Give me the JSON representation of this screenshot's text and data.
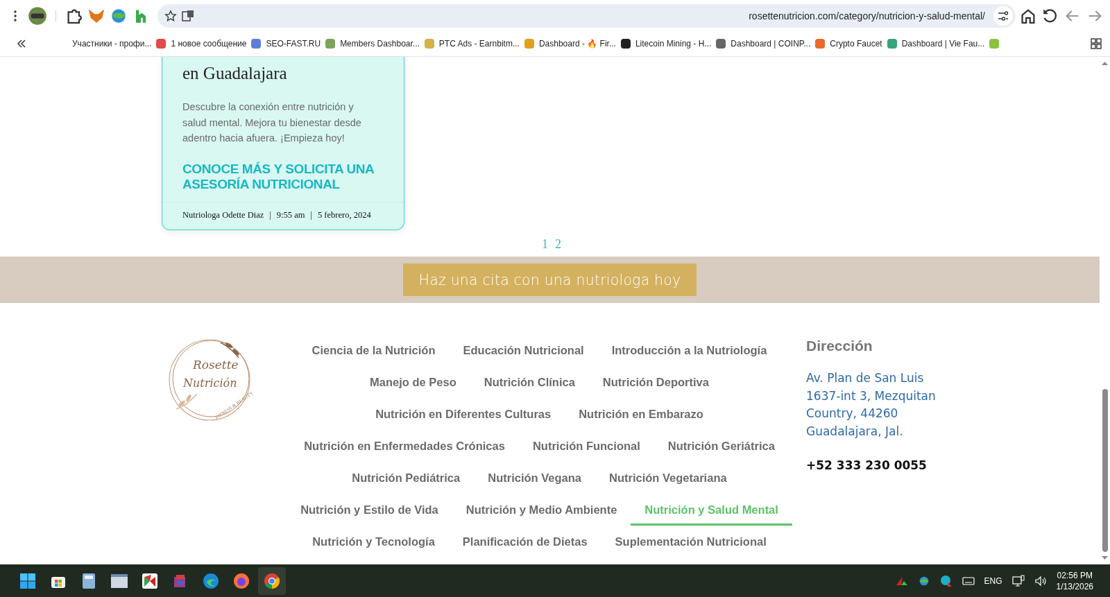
{
  "browser": {
    "url": "rosettenutricion.com/category/nutricion-y-salud-mental/",
    "bookmarks": [
      {
        "label": "Участники - профи..."
      },
      {
        "label": "1 новое сообщение"
      },
      {
        "label": "SEO-FAST.RU"
      },
      {
        "label": "Members Dashboar..."
      },
      {
        "label": "PTC Ads - Earnbitm..."
      },
      {
        "label": "Dashboard - 🔥 Fir..."
      },
      {
        "label": "Litecoin Mining - H..."
      },
      {
        "label": "Dashboard | COINP..."
      },
      {
        "label": "Crypto Faucet"
      },
      {
        "label": "Dashboard | Vie Fau..."
      }
    ]
  },
  "card": {
    "title": "en Guadalajara",
    "excerpt": "Descubre la conexión entre nutrición y salud mental. Mejora tu bienestar desde adentro hacia afuera. ¡Empieza hoy!",
    "link": "CONOCE MÁS Y SOLICITA UNA ASESORÍA NUTRICIONAL",
    "author": "Nutriologa Odette Diaz",
    "time": "9:55 am",
    "date": "5 febrero, 2024",
    "separator": "|"
  },
  "pagination": [
    {
      "label": "1"
    },
    {
      "label": "2"
    }
  ],
  "cta": {
    "button": "Haz una cita con una nutriologa hoy"
  },
  "footer": {
    "logo": {
      "line_1": "Rosette",
      "line_2": "Nutrición",
      "tagline": "FITNESS & BEAUTY"
    },
    "category_rows": [
      [
        {
          "label": "Ciencia de la Nutrición",
          "selected": false
        },
        {
          "label": "Educación Nutricional",
          "selected": false
        },
        {
          "label": "Introducción a la Nutriología",
          "selected": false
        }
      ],
      [
        {
          "label": "Manejo de Peso",
          "selected": false
        },
        {
          "label": "Nutrición Clínica",
          "selected": false
        },
        {
          "label": "Nutrición Deportiva",
          "selected": false
        }
      ],
      [
        {
          "label": "Nutrición en Diferentes Culturas",
          "selected": false
        },
        {
          "label": "Nutrición en Embarazo",
          "selected": false
        }
      ],
      [
        {
          "label": "Nutrición en Enfermedades Crónicas",
          "selected": false
        },
        {
          "label": "Nutrición Funcional",
          "selected": false
        },
        {
          "label": "Nutrición Geriátrica",
          "selected": false
        }
      ],
      [
        {
          "label": "Nutrición Pediátrica",
          "selected": false
        },
        {
          "label": "Nutrición Vegana",
          "selected": false
        },
        {
          "label": "Nutrición Vegetariana",
          "selected": false
        }
      ],
      [
        {
          "label": "Nutrición y Estilo de Vida",
          "selected": false
        },
        {
          "label": "Nutrición y Medio Ambiente",
          "selected": false
        },
        {
          "label": "Nutrición y Salud Mental",
          "selected": true
        }
      ],
      [
        {
          "label": "Nutrición y Tecnología",
          "selected": false
        },
        {
          "label": "Planificación de Dietas",
          "selected": false
        },
        {
          "label": "Suplementación Nutricional",
          "selected": false
        }
      ]
    ],
    "address_heading": "Dirección",
    "address_lines": [
      "Av. Plan de San Luis",
      "1637-int 3, Mezquitan",
      "Country, 44260",
      "Guadalajara, Jal."
    ],
    "phone": "+52 333 230 0055"
  },
  "taskbar": {
    "language": "ENG",
    "time": "02:56 PM",
    "date": "1/13/2026"
  }
}
